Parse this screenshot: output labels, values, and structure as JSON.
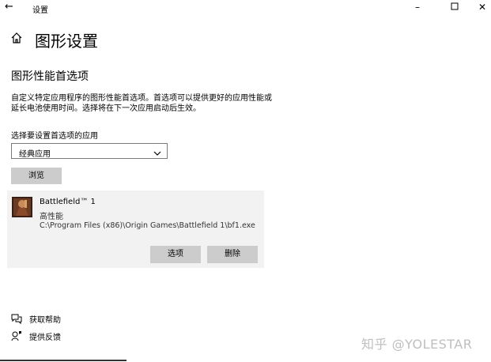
{
  "window": {
    "title": "设置"
  },
  "page": {
    "title": "图形设置"
  },
  "section": {
    "title": "图形性能首选项",
    "description": "自定义特定应用程序的图形性能首选项。首选项可以提供更好的应用性能或延长电池使用时间。选择将在下一次应用启动后生效。"
  },
  "selector": {
    "label": "选择要设置首选项的应用",
    "selected": "经典应用",
    "browse_label": "浏览"
  },
  "app_card": {
    "name": "Battlefield™ 1",
    "preference": "高性能",
    "path": "C:\\Program Files (x86)\\Origin Games\\Battlefield 1\\bf1.exe",
    "options_label": "选项",
    "delete_label": "删除"
  },
  "footer": {
    "help_label": "获取帮助",
    "feedback_label": "提供反馈"
  },
  "watermark": "知乎 @YOLESTAR"
}
